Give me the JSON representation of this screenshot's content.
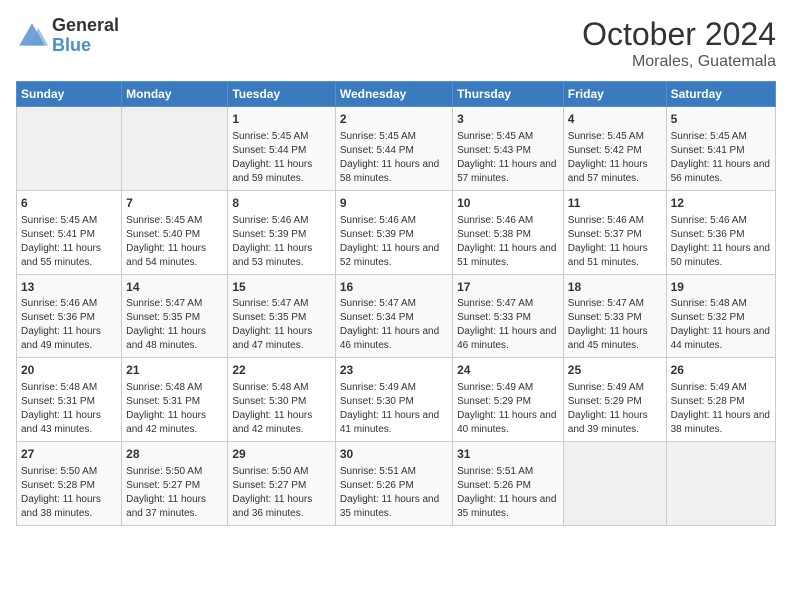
{
  "logo": {
    "line1": "General",
    "line2": "Blue"
  },
  "title": "October 2024",
  "location": "Morales, Guatemala",
  "days_of_week": [
    "Sunday",
    "Monday",
    "Tuesday",
    "Wednesday",
    "Thursday",
    "Friday",
    "Saturday"
  ],
  "weeks": [
    [
      {
        "day": "",
        "sunrise": "",
        "sunset": "",
        "daylight": ""
      },
      {
        "day": "",
        "sunrise": "",
        "sunset": "",
        "daylight": ""
      },
      {
        "day": "1",
        "sunrise": "Sunrise: 5:45 AM",
        "sunset": "Sunset: 5:44 PM",
        "daylight": "Daylight: 11 hours and 59 minutes."
      },
      {
        "day": "2",
        "sunrise": "Sunrise: 5:45 AM",
        "sunset": "Sunset: 5:44 PM",
        "daylight": "Daylight: 11 hours and 58 minutes."
      },
      {
        "day": "3",
        "sunrise": "Sunrise: 5:45 AM",
        "sunset": "Sunset: 5:43 PM",
        "daylight": "Daylight: 11 hours and 57 minutes."
      },
      {
        "day": "4",
        "sunrise": "Sunrise: 5:45 AM",
        "sunset": "Sunset: 5:42 PM",
        "daylight": "Daylight: 11 hours and 57 minutes."
      },
      {
        "day": "5",
        "sunrise": "Sunrise: 5:45 AM",
        "sunset": "Sunset: 5:41 PM",
        "daylight": "Daylight: 11 hours and 56 minutes."
      }
    ],
    [
      {
        "day": "6",
        "sunrise": "Sunrise: 5:45 AM",
        "sunset": "Sunset: 5:41 PM",
        "daylight": "Daylight: 11 hours and 55 minutes."
      },
      {
        "day": "7",
        "sunrise": "Sunrise: 5:45 AM",
        "sunset": "Sunset: 5:40 PM",
        "daylight": "Daylight: 11 hours and 54 minutes."
      },
      {
        "day": "8",
        "sunrise": "Sunrise: 5:46 AM",
        "sunset": "Sunset: 5:39 PM",
        "daylight": "Daylight: 11 hours and 53 minutes."
      },
      {
        "day": "9",
        "sunrise": "Sunrise: 5:46 AM",
        "sunset": "Sunset: 5:39 PM",
        "daylight": "Daylight: 11 hours and 52 minutes."
      },
      {
        "day": "10",
        "sunrise": "Sunrise: 5:46 AM",
        "sunset": "Sunset: 5:38 PM",
        "daylight": "Daylight: 11 hours and 51 minutes."
      },
      {
        "day": "11",
        "sunrise": "Sunrise: 5:46 AM",
        "sunset": "Sunset: 5:37 PM",
        "daylight": "Daylight: 11 hours and 51 minutes."
      },
      {
        "day": "12",
        "sunrise": "Sunrise: 5:46 AM",
        "sunset": "Sunset: 5:36 PM",
        "daylight": "Daylight: 11 hours and 50 minutes."
      }
    ],
    [
      {
        "day": "13",
        "sunrise": "Sunrise: 5:46 AM",
        "sunset": "Sunset: 5:36 PM",
        "daylight": "Daylight: 11 hours and 49 minutes."
      },
      {
        "day": "14",
        "sunrise": "Sunrise: 5:47 AM",
        "sunset": "Sunset: 5:35 PM",
        "daylight": "Daylight: 11 hours and 48 minutes."
      },
      {
        "day": "15",
        "sunrise": "Sunrise: 5:47 AM",
        "sunset": "Sunset: 5:35 PM",
        "daylight": "Daylight: 11 hours and 47 minutes."
      },
      {
        "day": "16",
        "sunrise": "Sunrise: 5:47 AM",
        "sunset": "Sunset: 5:34 PM",
        "daylight": "Daylight: 11 hours and 46 minutes."
      },
      {
        "day": "17",
        "sunrise": "Sunrise: 5:47 AM",
        "sunset": "Sunset: 5:33 PM",
        "daylight": "Daylight: 11 hours and 46 minutes."
      },
      {
        "day": "18",
        "sunrise": "Sunrise: 5:47 AM",
        "sunset": "Sunset: 5:33 PM",
        "daylight": "Daylight: 11 hours and 45 minutes."
      },
      {
        "day": "19",
        "sunrise": "Sunrise: 5:48 AM",
        "sunset": "Sunset: 5:32 PM",
        "daylight": "Daylight: 11 hours and 44 minutes."
      }
    ],
    [
      {
        "day": "20",
        "sunrise": "Sunrise: 5:48 AM",
        "sunset": "Sunset: 5:31 PM",
        "daylight": "Daylight: 11 hours and 43 minutes."
      },
      {
        "day": "21",
        "sunrise": "Sunrise: 5:48 AM",
        "sunset": "Sunset: 5:31 PM",
        "daylight": "Daylight: 11 hours and 42 minutes."
      },
      {
        "day": "22",
        "sunrise": "Sunrise: 5:48 AM",
        "sunset": "Sunset: 5:30 PM",
        "daylight": "Daylight: 11 hours and 42 minutes."
      },
      {
        "day": "23",
        "sunrise": "Sunrise: 5:49 AM",
        "sunset": "Sunset: 5:30 PM",
        "daylight": "Daylight: 11 hours and 41 minutes."
      },
      {
        "day": "24",
        "sunrise": "Sunrise: 5:49 AM",
        "sunset": "Sunset: 5:29 PM",
        "daylight": "Daylight: 11 hours and 40 minutes."
      },
      {
        "day": "25",
        "sunrise": "Sunrise: 5:49 AM",
        "sunset": "Sunset: 5:29 PM",
        "daylight": "Daylight: 11 hours and 39 minutes."
      },
      {
        "day": "26",
        "sunrise": "Sunrise: 5:49 AM",
        "sunset": "Sunset: 5:28 PM",
        "daylight": "Daylight: 11 hours and 38 minutes."
      }
    ],
    [
      {
        "day": "27",
        "sunrise": "Sunrise: 5:50 AM",
        "sunset": "Sunset: 5:28 PM",
        "daylight": "Daylight: 11 hours and 38 minutes."
      },
      {
        "day": "28",
        "sunrise": "Sunrise: 5:50 AM",
        "sunset": "Sunset: 5:27 PM",
        "daylight": "Daylight: 11 hours and 37 minutes."
      },
      {
        "day": "29",
        "sunrise": "Sunrise: 5:50 AM",
        "sunset": "Sunset: 5:27 PM",
        "daylight": "Daylight: 11 hours and 36 minutes."
      },
      {
        "day": "30",
        "sunrise": "Sunrise: 5:51 AM",
        "sunset": "Sunset: 5:26 PM",
        "daylight": "Daylight: 11 hours and 35 minutes."
      },
      {
        "day": "31",
        "sunrise": "Sunrise: 5:51 AM",
        "sunset": "Sunset: 5:26 PM",
        "daylight": "Daylight: 11 hours and 35 minutes."
      },
      {
        "day": "",
        "sunrise": "",
        "sunset": "",
        "daylight": ""
      },
      {
        "day": "",
        "sunrise": "",
        "sunset": "",
        "daylight": ""
      }
    ]
  ]
}
